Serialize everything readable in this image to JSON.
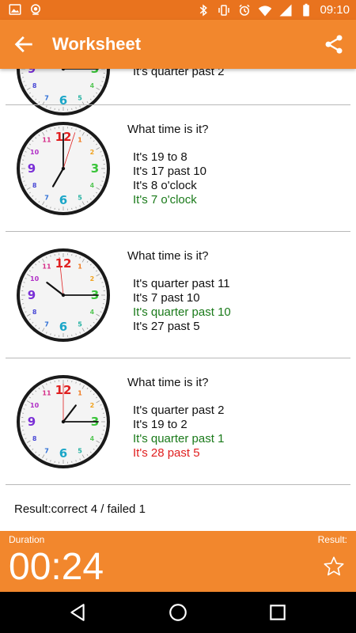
{
  "statusbar": {
    "time": "09:10"
  },
  "appbar": {
    "title": "Worksheet"
  },
  "partial_item": {
    "answer": "It's quarter past 2",
    "hour": 2,
    "minute": 15
  },
  "items": [
    {
      "question": "What time is it?",
      "hour": 7,
      "minute": 0,
      "second": 3,
      "answers": [
        {
          "text": "It's 19 to 8",
          "state": "normal"
        },
        {
          "text": "It's 17 past 10",
          "state": "normal"
        },
        {
          "text": "It's 8 o'clock",
          "state": "normal"
        },
        {
          "text": "It's 7 o'clock",
          "state": "correct"
        }
      ]
    },
    {
      "question": "What time is it?",
      "hour": 10,
      "minute": 15,
      "second": 59,
      "answers": [
        {
          "text": "It's quarter past 11",
          "state": "normal"
        },
        {
          "text": "It's 7 past 10",
          "state": "normal"
        },
        {
          "text": "It's quarter past 10",
          "state": "correct"
        },
        {
          "text": "It's 27 past 5",
          "state": "normal"
        }
      ]
    },
    {
      "question": "What time is it?",
      "hour": 1,
      "minute": 15,
      "second": 0,
      "answers": [
        {
          "text": "It's quarter past 2",
          "state": "normal"
        },
        {
          "text": "It's 19 to 2",
          "state": "normal"
        },
        {
          "text": "It's quarter past 1",
          "state": "correct"
        },
        {
          "text": "It's 28 past 5",
          "state": "wrong"
        }
      ]
    }
  ],
  "result": {
    "text": "Result:correct 4 / failed 1"
  },
  "panel": {
    "duration_label": "Duration",
    "duration_value": "00:24",
    "result_label": "Result:"
  },
  "colors": {
    "statusbar": "#e9731e",
    "appbar": "#f2872d",
    "correct": "#1a7a1a",
    "wrong": "#e01e1e",
    "numerals": {
      "12": "#e02020",
      "1": "#f07a1e",
      "2": "#f0a21e",
      "3": "#3ac43a",
      "4": "#5bc85b",
      "5": "#20b0a0",
      "6": "#1aa6c8",
      "7": "#2f6fd6",
      "8": "#4a4ad6",
      "9": "#7a2fd6",
      "10": "#b02fc6",
      "11": "#d62f8a"
    }
  },
  "icons": {
    "status_left": [
      "image-icon",
      "camera-icon"
    ],
    "status_right": [
      "bluetooth-icon",
      "vibrate-icon",
      "alarm-icon",
      "wifi-icon",
      "signal-icon",
      "battery-icon"
    ],
    "appbar": [
      "back-arrow-icon",
      "share-icon"
    ],
    "panel": [
      "star-outline-icon"
    ],
    "nav": [
      "back-triangle-icon",
      "home-circle-icon",
      "recents-square-icon"
    ]
  }
}
